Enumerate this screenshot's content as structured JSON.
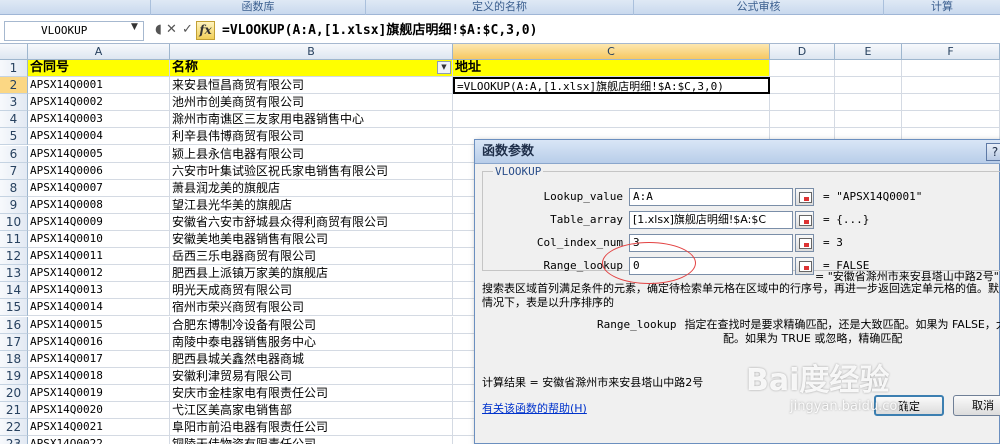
{
  "ribbon": {
    "groups": [
      "函数库",
      "定义的名称",
      "公式审核",
      "计算"
    ]
  },
  "formula_bar": {
    "name_box": "VLOOKUP",
    "cancel_icon": "✕",
    "enter_icon": "✓",
    "fx_label": "fx",
    "formula": "=VLOOKUP(A:A,[1.xlsx]旗舰店明细!$A:$C,3,0)"
  },
  "sheet": {
    "columns": [
      "A",
      "B",
      "C",
      "D",
      "E",
      "F"
    ],
    "rows": [
      {
        "n": "1",
        "a": "合同号",
        "b": "名称",
        "c": "地址"
      },
      {
        "n": "2",
        "a": "APSX14Q0001",
        "b": "来安县恒昌商贸有限公司",
        "c": "=VLOOKUP(A:A,[1.xlsx]旗舰店明细!$A:$C,3,0)"
      },
      {
        "n": "3",
        "a": "APSX14Q0002",
        "b": "池州市创美商贸有限公司",
        "c": ""
      },
      {
        "n": "4",
        "a": "APSX14Q0003",
        "b": "滁州市南谯区三友家用电器销售中心",
        "c": ""
      },
      {
        "n": "5",
        "a": "APSX14Q0004",
        "b": "利辛县伟博商贸有限公司",
        "c": ""
      },
      {
        "n": "6",
        "a": "APSX14Q0005",
        "b": "颍上县永信电器有限公司",
        "c": ""
      },
      {
        "n": "7",
        "a": "APSX14Q0006",
        "b": "六安市叶集试验区祝氏家电销售有限公司",
        "c": ""
      },
      {
        "n": "8",
        "a": "APSX14Q0007",
        "b": "萧县润龙美的旗舰店",
        "c": ""
      },
      {
        "n": "9",
        "a": "APSX14Q0008",
        "b": "望江县光华美的旗舰店",
        "c": ""
      },
      {
        "n": "10",
        "a": "APSX14Q0009",
        "b": "安徽省六安市舒城县众得利商贸有限公司",
        "c": ""
      },
      {
        "n": "11",
        "a": "APSX14Q0010",
        "b": "安徽美地美电器销售有限公司",
        "c": ""
      },
      {
        "n": "12",
        "a": "APSX14Q0011",
        "b": "岳西三乐电器商贸有限公司",
        "c": ""
      },
      {
        "n": "13",
        "a": "APSX14Q0012",
        "b": "肥西县上派镇万家美的旗舰店",
        "c": ""
      },
      {
        "n": "14",
        "a": "APSX14Q0013",
        "b": "明光天成商贸有限公司",
        "c": ""
      },
      {
        "n": "15",
        "a": "APSX14Q0014",
        "b": "宿州市荣兴商贸有限公司",
        "c": ""
      },
      {
        "n": "16",
        "a": "APSX14Q0015",
        "b": "合肥东博制冷设备有限公司",
        "c": ""
      },
      {
        "n": "17",
        "a": "APSX14Q0016",
        "b": "南陵中泰电器销售服务中心",
        "c": ""
      },
      {
        "n": "18",
        "a": "APSX14Q0017",
        "b": "肥西县城关鑫然电器商城",
        "c": ""
      },
      {
        "n": "19",
        "a": "APSX14Q0018",
        "b": "安徽利津贸易有限公司",
        "c": ""
      },
      {
        "n": "20",
        "a": "APSX14Q0019",
        "b": "安庆市金桂家电有限责任公司",
        "c": ""
      },
      {
        "n": "21",
        "a": "APSX14Q0020",
        "b": "弋江区美高家电销售部",
        "c": ""
      },
      {
        "n": "22",
        "a": "APSX14Q0021",
        "b": "阜阳市前沿电器有限责任公司",
        "c": ""
      },
      {
        "n": "23",
        "a": "APSX14Q0022",
        "b": "铜陵天佳物资有限责任公司",
        "c": ""
      }
    ]
  },
  "dialog": {
    "title": "函数参数",
    "close_label": "?",
    "function_name": "VLOOKUP",
    "args": [
      {
        "label": "Lookup_value",
        "input": "A:A",
        "value": "= \"APSX14Q0001\""
      },
      {
        "label": "Table_array",
        "input": "[1.xlsx]旗舰店明细!$A:$C",
        "value": "= {...}"
      },
      {
        "label": "Col_index_num",
        "input": "3",
        "value": "= 3"
      },
      {
        "label": "Range_lookup",
        "input": "0",
        "value": "= FALSE"
      }
    ],
    "result_preview": "= \"安徽省滁州市来安县塔山中路2号\"",
    "description_line1": "搜索表区域首列满足条件的元素，确定待检索单元格在区域中的行序号，再进一步返回选定单元格的值。默",
    "description_line2": "情况下，表是以升序排序的",
    "param_name": "Range_lookup",
    "param_desc_line1": "指定在查找时是要求精确匹配，还是大致匹配。如果为 FALSE，大",
    "param_desc_line2": "配。如果为 TRUE 或忽略，精确匹配",
    "calc_result": "计算结果 = 安徽省滁州市来安县塔山中路2号",
    "help_link": "有关该函数的帮助(H)",
    "ok_label": "确定",
    "cancel_label": "取消"
  },
  "watermark": {
    "logo": "Bai度经验",
    "url": "jingyan.baidu.com"
  }
}
